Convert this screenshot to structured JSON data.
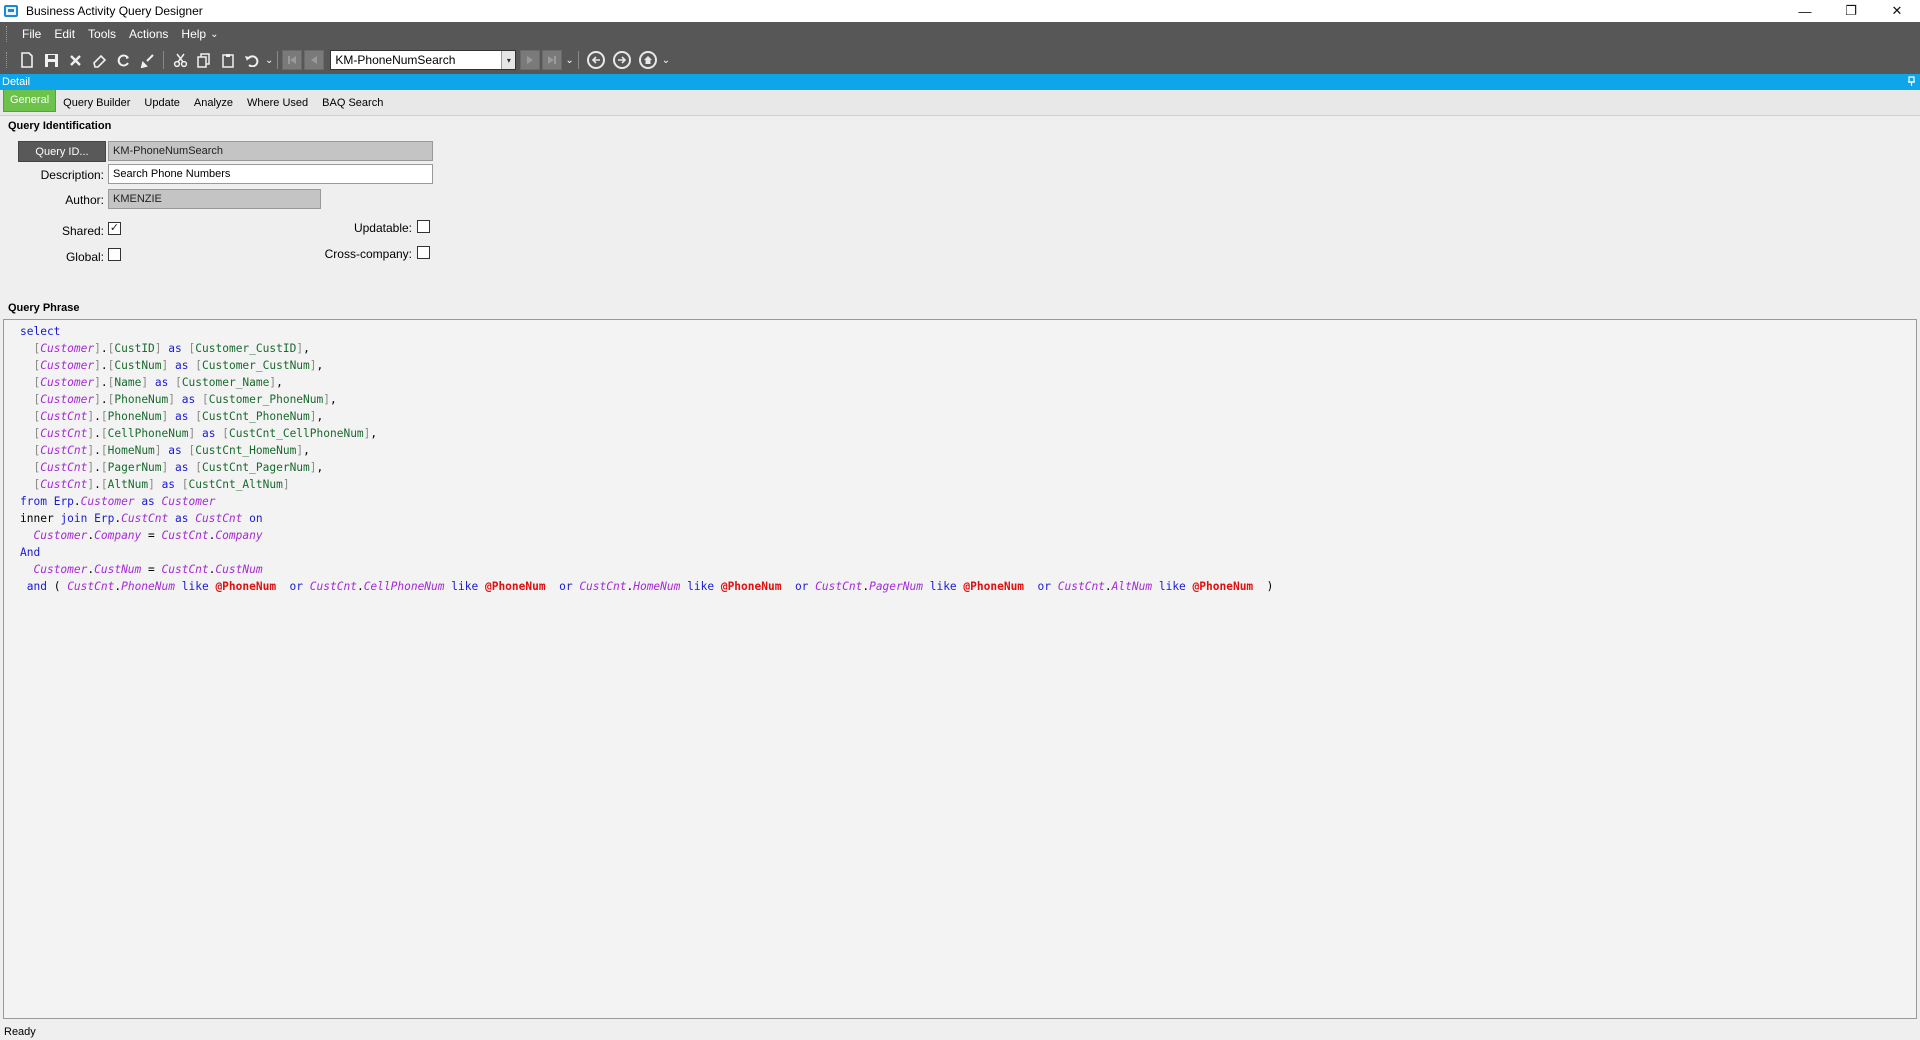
{
  "window": {
    "title": "Business Activity Query Designer",
    "minimize": "—",
    "restore": "❐",
    "close": "✕"
  },
  "menu": {
    "items": [
      "File",
      "Edit",
      "Tools",
      "Actions",
      "Help"
    ],
    "overflow": "⌄"
  },
  "toolbar": {
    "record_value": "KM-PhoneNumSearch",
    "combo_arrow": "▾"
  },
  "detail_bar": {
    "label": "Detail",
    "pin": "📌"
  },
  "tabs": [
    {
      "label": "General",
      "active": true
    },
    {
      "label": "Query Builder",
      "active": false
    },
    {
      "label": "Update",
      "active": false
    },
    {
      "label": "Analyze",
      "active": false
    },
    {
      "label": "Where Used",
      "active": false
    },
    {
      "label": "BAQ Search",
      "active": false
    }
  ],
  "query_identification": {
    "title": "Query Identification",
    "query_id_label": "Query ID...",
    "query_id_value": "KM-PhoneNumSearch",
    "description_label": "Description:",
    "description_value": "Search Phone Numbers",
    "author_label": "Author:",
    "author_value": "KMENZIE",
    "shared_label": "Shared:",
    "shared_checked": true,
    "global_label": "Global:",
    "global_checked": false,
    "updatable_label": "Updatable:",
    "updatable_checked": false,
    "cross_company_label": "Cross-company:",
    "cross_company_checked": false,
    "check_mark": "✓"
  },
  "query_phrase": {
    "title": "Query Phrase",
    "lines": [
      [
        [
          "kw",
          "select"
        ]
      ],
      [
        [
          "plain",
          "  "
        ],
        [
          "br",
          "["
        ],
        [
          "tbl",
          "Customer"
        ],
        [
          "br",
          "]"
        ],
        [
          "plain",
          "."
        ],
        [
          "br",
          "["
        ],
        [
          "col",
          "CustID"
        ],
        [
          "br",
          "]"
        ],
        [
          "plain",
          " "
        ],
        [
          "kw",
          "as"
        ],
        [
          "plain",
          " "
        ],
        [
          "br",
          "["
        ],
        [
          "col",
          "Customer_CustID"
        ],
        [
          "br",
          "]"
        ],
        [
          "plain",
          ","
        ]
      ],
      [
        [
          "plain",
          "  "
        ],
        [
          "br",
          "["
        ],
        [
          "tbl",
          "Customer"
        ],
        [
          "br",
          "]"
        ],
        [
          "plain",
          "."
        ],
        [
          "br",
          "["
        ],
        [
          "col",
          "CustNum"
        ],
        [
          "br",
          "]"
        ],
        [
          "plain",
          " "
        ],
        [
          "kw",
          "as"
        ],
        [
          "plain",
          " "
        ],
        [
          "br",
          "["
        ],
        [
          "col",
          "Customer_CustNum"
        ],
        [
          "br",
          "]"
        ],
        [
          "plain",
          ","
        ]
      ],
      [
        [
          "plain",
          "  "
        ],
        [
          "br",
          "["
        ],
        [
          "tbl",
          "Customer"
        ],
        [
          "br",
          "]"
        ],
        [
          "plain",
          "."
        ],
        [
          "br",
          "["
        ],
        [
          "col",
          "Name"
        ],
        [
          "br",
          "]"
        ],
        [
          "plain",
          " "
        ],
        [
          "kw",
          "as"
        ],
        [
          "plain",
          " "
        ],
        [
          "br",
          "["
        ],
        [
          "col",
          "Customer_Name"
        ],
        [
          "br",
          "]"
        ],
        [
          "plain",
          ","
        ]
      ],
      [
        [
          "plain",
          "  "
        ],
        [
          "br",
          "["
        ],
        [
          "tbl",
          "Customer"
        ],
        [
          "br",
          "]"
        ],
        [
          "plain",
          "."
        ],
        [
          "br",
          "["
        ],
        [
          "col",
          "PhoneNum"
        ],
        [
          "br",
          "]"
        ],
        [
          "plain",
          " "
        ],
        [
          "kw",
          "as"
        ],
        [
          "plain",
          " "
        ],
        [
          "br",
          "["
        ],
        [
          "col",
          "Customer_PhoneNum"
        ],
        [
          "br",
          "]"
        ],
        [
          "plain",
          ","
        ]
      ],
      [
        [
          "plain",
          "  "
        ],
        [
          "br",
          "["
        ],
        [
          "tbl",
          "CustCnt"
        ],
        [
          "br",
          "]"
        ],
        [
          "plain",
          "."
        ],
        [
          "br",
          "["
        ],
        [
          "col",
          "PhoneNum"
        ],
        [
          "br",
          "]"
        ],
        [
          "plain",
          " "
        ],
        [
          "kw",
          "as"
        ],
        [
          "plain",
          " "
        ],
        [
          "br",
          "["
        ],
        [
          "col",
          "CustCnt_PhoneNum"
        ],
        [
          "br",
          "]"
        ],
        [
          "plain",
          ","
        ]
      ],
      [
        [
          "plain",
          "  "
        ],
        [
          "br",
          "["
        ],
        [
          "tbl",
          "CustCnt"
        ],
        [
          "br",
          "]"
        ],
        [
          "plain",
          "."
        ],
        [
          "br",
          "["
        ],
        [
          "col",
          "CellPhoneNum"
        ],
        [
          "br",
          "]"
        ],
        [
          "plain",
          " "
        ],
        [
          "kw",
          "as"
        ],
        [
          "plain",
          " "
        ],
        [
          "br",
          "["
        ],
        [
          "col",
          "CustCnt_CellPhoneNum"
        ],
        [
          "br",
          "]"
        ],
        [
          "plain",
          ","
        ]
      ],
      [
        [
          "plain",
          "  "
        ],
        [
          "br",
          "["
        ],
        [
          "tbl",
          "CustCnt"
        ],
        [
          "br",
          "]"
        ],
        [
          "plain",
          "."
        ],
        [
          "br",
          "["
        ],
        [
          "col",
          "HomeNum"
        ],
        [
          "br",
          "]"
        ],
        [
          "plain",
          " "
        ],
        [
          "kw",
          "as"
        ],
        [
          "plain",
          " "
        ],
        [
          "br",
          "["
        ],
        [
          "col",
          "CustCnt_HomeNum"
        ],
        [
          "br",
          "]"
        ],
        [
          "plain",
          ","
        ]
      ],
      [
        [
          "plain",
          "  "
        ],
        [
          "br",
          "["
        ],
        [
          "tbl",
          "CustCnt"
        ],
        [
          "br",
          "]"
        ],
        [
          "plain",
          "."
        ],
        [
          "br",
          "["
        ],
        [
          "col",
          "PagerNum"
        ],
        [
          "br",
          "]"
        ],
        [
          "plain",
          " "
        ],
        [
          "kw",
          "as"
        ],
        [
          "plain",
          " "
        ],
        [
          "br",
          "["
        ],
        [
          "col",
          "CustCnt_PagerNum"
        ],
        [
          "br",
          "]"
        ],
        [
          "plain",
          ","
        ]
      ],
      [
        [
          "plain",
          "  "
        ],
        [
          "br",
          "["
        ],
        [
          "tbl",
          "CustCnt"
        ],
        [
          "br",
          "]"
        ],
        [
          "plain",
          "."
        ],
        [
          "br",
          "["
        ],
        [
          "col",
          "AltNum"
        ],
        [
          "br",
          "]"
        ],
        [
          "plain",
          " "
        ],
        [
          "kw",
          "as"
        ],
        [
          "plain",
          " "
        ],
        [
          "br",
          "["
        ],
        [
          "col",
          "CustCnt_AltNum"
        ],
        [
          "br",
          "]"
        ]
      ],
      [
        [
          "kw",
          "from"
        ],
        [
          "plain",
          " "
        ],
        [
          "kw",
          "Erp"
        ],
        [
          "plain",
          "."
        ],
        [
          "tbl",
          "Customer"
        ],
        [
          "plain",
          " "
        ],
        [
          "kw",
          "as"
        ],
        [
          "plain",
          " "
        ],
        [
          "tbl",
          "Customer"
        ]
      ],
      [
        [
          "plain",
          "inner"
        ],
        [
          "plain",
          " "
        ],
        [
          "kw",
          "join"
        ],
        [
          "plain",
          " "
        ],
        [
          "kw",
          "Erp"
        ],
        [
          "plain",
          "."
        ],
        [
          "tbl",
          "CustCnt"
        ],
        [
          "plain",
          " "
        ],
        [
          "kw",
          "as"
        ],
        [
          "plain",
          " "
        ],
        [
          "tbl",
          "CustCnt"
        ],
        [
          "plain",
          " "
        ],
        [
          "kw",
          "on"
        ]
      ],
      [
        [
          "plain",
          "  "
        ],
        [
          "tbl",
          "Customer"
        ],
        [
          "plain",
          "."
        ],
        [
          "tbl",
          "Company"
        ],
        [
          "plain",
          " = "
        ],
        [
          "tbl",
          "CustCnt"
        ],
        [
          "plain",
          "."
        ],
        [
          "tbl",
          "Company"
        ]
      ],
      [
        [
          "kw",
          "And"
        ]
      ],
      [
        [
          "plain",
          "  "
        ],
        [
          "tbl",
          "Customer"
        ],
        [
          "plain",
          "."
        ],
        [
          "tbl",
          "CustNum"
        ],
        [
          "plain",
          " = "
        ],
        [
          "tbl",
          "CustCnt"
        ],
        [
          "plain",
          "."
        ],
        [
          "tbl",
          "CustNum"
        ]
      ],
      [
        [
          "plain",
          " "
        ],
        [
          "kw",
          "and"
        ],
        [
          "plain",
          " ( "
        ],
        [
          "tbl",
          "CustCnt"
        ],
        [
          "plain",
          "."
        ],
        [
          "tbl",
          "PhoneNum"
        ],
        [
          "plain",
          " "
        ],
        [
          "kw",
          "like"
        ],
        [
          "plain",
          " "
        ],
        [
          "par",
          "@PhoneNum"
        ],
        [
          "plain",
          "  "
        ],
        [
          "kw",
          "or"
        ],
        [
          "plain",
          " "
        ],
        [
          "tbl",
          "CustCnt"
        ],
        [
          "plain",
          "."
        ],
        [
          "tbl",
          "CellPhoneNum"
        ],
        [
          "plain",
          " "
        ],
        [
          "kw",
          "like"
        ],
        [
          "plain",
          " "
        ],
        [
          "par",
          "@PhoneNum"
        ],
        [
          "plain",
          "  "
        ],
        [
          "kw",
          "or"
        ],
        [
          "plain",
          " "
        ],
        [
          "tbl",
          "CustCnt"
        ],
        [
          "plain",
          "."
        ],
        [
          "tbl",
          "HomeNum"
        ],
        [
          "plain",
          " "
        ],
        [
          "kw",
          "like"
        ],
        [
          "plain",
          " "
        ],
        [
          "par",
          "@PhoneNum"
        ],
        [
          "plain",
          "  "
        ],
        [
          "kw",
          "or"
        ],
        [
          "plain",
          " "
        ],
        [
          "tbl",
          "CustCnt"
        ],
        [
          "plain",
          "."
        ],
        [
          "tbl",
          "PagerNum"
        ],
        [
          "plain",
          " "
        ],
        [
          "kw",
          "like"
        ],
        [
          "plain",
          " "
        ],
        [
          "par",
          "@PhoneNum"
        ],
        [
          "plain",
          "  "
        ],
        [
          "kw",
          "or"
        ],
        [
          "plain",
          " "
        ],
        [
          "tbl",
          "CustCnt"
        ],
        [
          "plain",
          "."
        ],
        [
          "tbl",
          "AltNum"
        ],
        [
          "plain",
          " "
        ],
        [
          "kw",
          "like"
        ],
        [
          "plain",
          " "
        ],
        [
          "par",
          "@PhoneNum"
        ],
        [
          "plain",
          "  )"
        ]
      ]
    ]
  },
  "status": {
    "text": "Ready"
  }
}
